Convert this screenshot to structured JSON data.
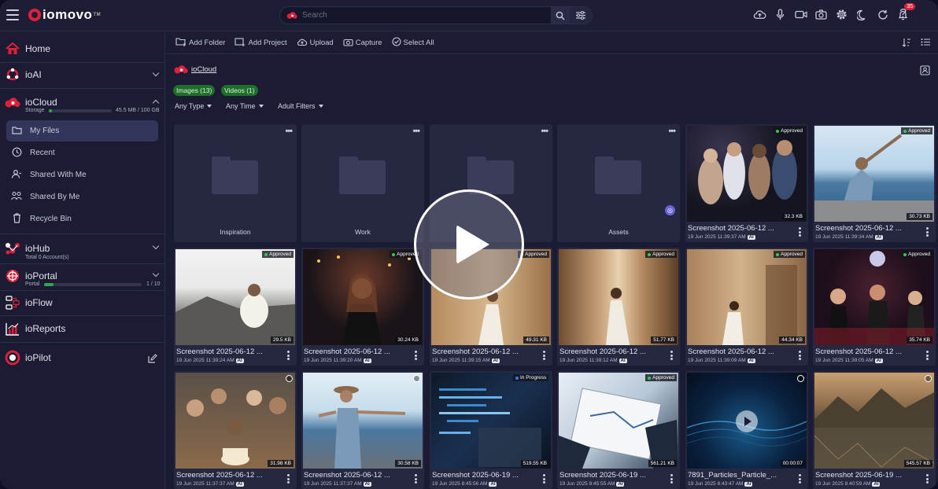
{
  "app": {
    "logo_text": "iomovo",
    "logo_tm": "TM"
  },
  "header": {
    "search_placeholder": "Search",
    "notification_count": "35",
    "icons": [
      "upload-cloud-icon",
      "microphone-icon",
      "video-camera-icon",
      "camera-icon",
      "gear-icon",
      "moon-icon",
      "refresh-icon",
      "bell-icon",
      "help-icon"
    ]
  },
  "sidebar": {
    "home": "Home",
    "ioai": "ioAI",
    "iocloud": "ioCloud",
    "storage_label": "Storage",
    "storage_value": "45.5 MB / 100 GB",
    "storage_fraction": 0.05,
    "items": [
      {
        "label": "My Files",
        "icon": "folder-icon",
        "active": true
      },
      {
        "label": "Recent",
        "icon": "clock-icon",
        "active": false
      },
      {
        "label": "Shared With Me",
        "icon": "shared-with-me-icon",
        "active": false
      },
      {
        "label": "Shared By Me",
        "icon": "shared-by-me-icon",
        "active": false
      },
      {
        "label": "Recycle Bin",
        "icon": "trash-icon",
        "active": false
      }
    ],
    "iohub": "ioHub",
    "iohub_sub": "Total 0 Account(s)",
    "ioportal": "ioPortal",
    "portal_label": "Portal",
    "portal_value": "1 / 10",
    "portal_fraction": 0.1,
    "ioflow": "ioFlow",
    "ioreports": "ioReports",
    "iopilot": "ioPilot"
  },
  "toolbar": {
    "add_folder": "Add Folder",
    "add_project": "Add Project",
    "upload": "Upload",
    "capture": "Capture",
    "select_all": "Select All"
  },
  "breadcrumb": "ioCloud",
  "pills": {
    "images": "Images (13)",
    "videos": "Videos (1)"
  },
  "filters": {
    "type": "Any Type",
    "time": "Any Time",
    "adult": "Adult Filters"
  },
  "folders": [
    {
      "name": "Inspiration"
    },
    {
      "name": "Work"
    },
    {
      "name": ""
    },
    {
      "name": "Assets"
    }
  ],
  "row1_media": [
    {
      "name": "Screenshot 2025-06-12 ...",
      "date": "19 Jun 2025 11:39:37 AM",
      "size": "32.3 KB",
      "status": "Approved",
      "ai": "AI"
    },
    {
      "name": "Screenshot 2025-06-12 ...",
      "date": "19 Jun 2025 11:39:34 AM",
      "size": "30.73 KB",
      "status": "Approved",
      "ai": "AI"
    }
  ],
  "row2_media": [
    {
      "name": "Screenshot 2025-06-12 ...",
      "date": "19 Jun 2025 11:39:24 AM",
      "size": "29.5 KB",
      "status": "Approved",
      "ai": "AI"
    },
    {
      "name": "Screenshot 2025-06-12 ...",
      "date": "19 Jun 2025 11:39:20 AM",
      "size": "30.24 KB",
      "status": "Approved",
      "ai": "AI"
    },
    {
      "name": "Screenshot 2025-06-12 ...",
      "date": "19 Jun 2025 11:39:15 AM",
      "size": "49.31 KB",
      "status": "Approved",
      "ai": "AI"
    },
    {
      "name": "Screenshot 2025-06-12 ...",
      "date": "19 Jun 2025 11:39:12 AM",
      "size": "51.77 KB",
      "status": "Approved",
      "ai": "AI"
    },
    {
      "name": "Screenshot 2025-06-12 ...",
      "date": "19 Jun 2025 11:39:09 AM",
      "size": "44.34 KB",
      "status": "Approved",
      "ai": "AI"
    },
    {
      "name": "Screenshot 2025-06-12 ...",
      "date": "19 Jun 2025 11:39:05 AM",
      "size": "35.74 KB",
      "status": "Approved",
      "ai": "AI"
    }
  ],
  "row3_media": [
    {
      "name": "Screenshot 2025-06-12 ...",
      "date": "19 Jun 2025 11:37:37 AM",
      "size": "31.98 KB",
      "status": "",
      "ai": "AI"
    },
    {
      "name": "Screenshot 2025-06-12 ...",
      "date": "19 Jun 2025 11:37:37 AM",
      "size": "30.58 KB",
      "status": "",
      "ai": "AI"
    },
    {
      "name": "Screenshot 2025-06-19 ...",
      "date": "19 Jun 2025 8:45:56 AM",
      "size": "519.55 KB",
      "status": "In Progress",
      "ai": "AI"
    },
    {
      "name": "Screenshot 2025-06-19 ...",
      "date": "19 Jun 2025 8:45:55 AM",
      "size": "561.21 KB",
      "status": "Approved",
      "ai": "AI"
    },
    {
      "name": "7891_Particles_Particle_...",
      "date": "19 Jun 2025 8:43:47 AM",
      "size": "00:00:07",
      "status": "",
      "ai": "AI"
    },
    {
      "name": "Screenshot 2025-06-19 ...",
      "date": "19 Jun 2025 8:40:59 AM",
      "size": "545.57 KB",
      "status": "",
      "ai": "AI"
    }
  ],
  "colors": {
    "accent_red": "#e0203a",
    "approved_green": "#2ecc51",
    "progress_blue": "#3a7cf0",
    "pill_green": "#1f6e2b"
  }
}
